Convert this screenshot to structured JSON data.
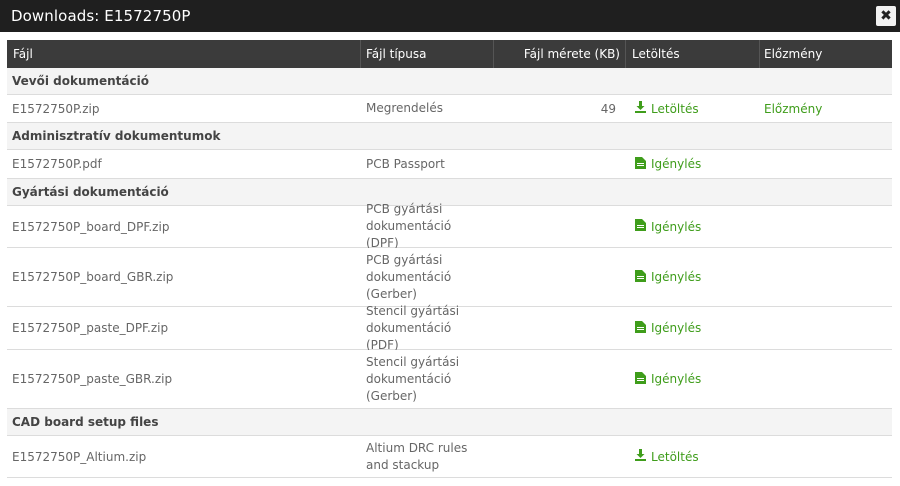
{
  "window": {
    "title": "Downloads: E1572750P",
    "close_icon": "close-icon"
  },
  "columns": {
    "file": "Fájl",
    "type": "Fájl típusa",
    "size": "Fájl mérete (KB)",
    "download": "Letöltés",
    "history": "Előzmény"
  },
  "sections": [
    {
      "title": "Vevői dokumentáció",
      "rows": [
        {
          "file": "E1572750P.zip",
          "type": "Megrendelés",
          "size": "49",
          "action": "Letöltés",
          "action_icon": "download-icon",
          "history": "Előzmény"
        }
      ]
    },
    {
      "title": "Adminisztratív dokumentumok",
      "rows": [
        {
          "file": "E1572750P.pdf",
          "type": "PCB Passport",
          "size": "",
          "action": "Igénylés",
          "action_icon": "document-icon",
          "history": ""
        }
      ]
    },
    {
      "title": "Gyártási dokumentáció",
      "rows": [
        {
          "file": "E1572750P_board_DPF.zip",
          "type": "PCB gyártási dokumentáció (DPF)",
          "size": "",
          "action": "Igénylés",
          "action_icon": "document-icon",
          "history": ""
        },
        {
          "file": "E1572750P_board_GBR.zip",
          "type": "PCB gyártási dokumentáció (Gerber)",
          "size": "",
          "action": "Igénylés",
          "action_icon": "document-icon",
          "history": ""
        },
        {
          "file": "E1572750P_paste_DPF.zip",
          "type": "Stencil gyártási dokumentáció (PDF)",
          "size": "",
          "action": "Igénylés",
          "action_icon": "document-icon",
          "history": ""
        },
        {
          "file": "E1572750P_paste_GBR.zip",
          "type": "Stencil gyártási dokumentáció (Gerber)",
          "size": "",
          "action": "Igénylés",
          "action_icon": "document-icon",
          "history": ""
        }
      ]
    },
    {
      "title": "CAD board setup files",
      "rows": [
        {
          "file": "E1572750P_Altium.zip",
          "type": "Altium DRC rules and stackup",
          "size": "",
          "action": "Letöltés",
          "action_icon": "download-icon",
          "history": ""
        }
      ]
    }
  ],
  "colors": {
    "header_bg": "#3b3b3b",
    "title_bg": "#1f1f1f",
    "link": "#3f9d1b",
    "section_bg": "#f4f4f4"
  }
}
